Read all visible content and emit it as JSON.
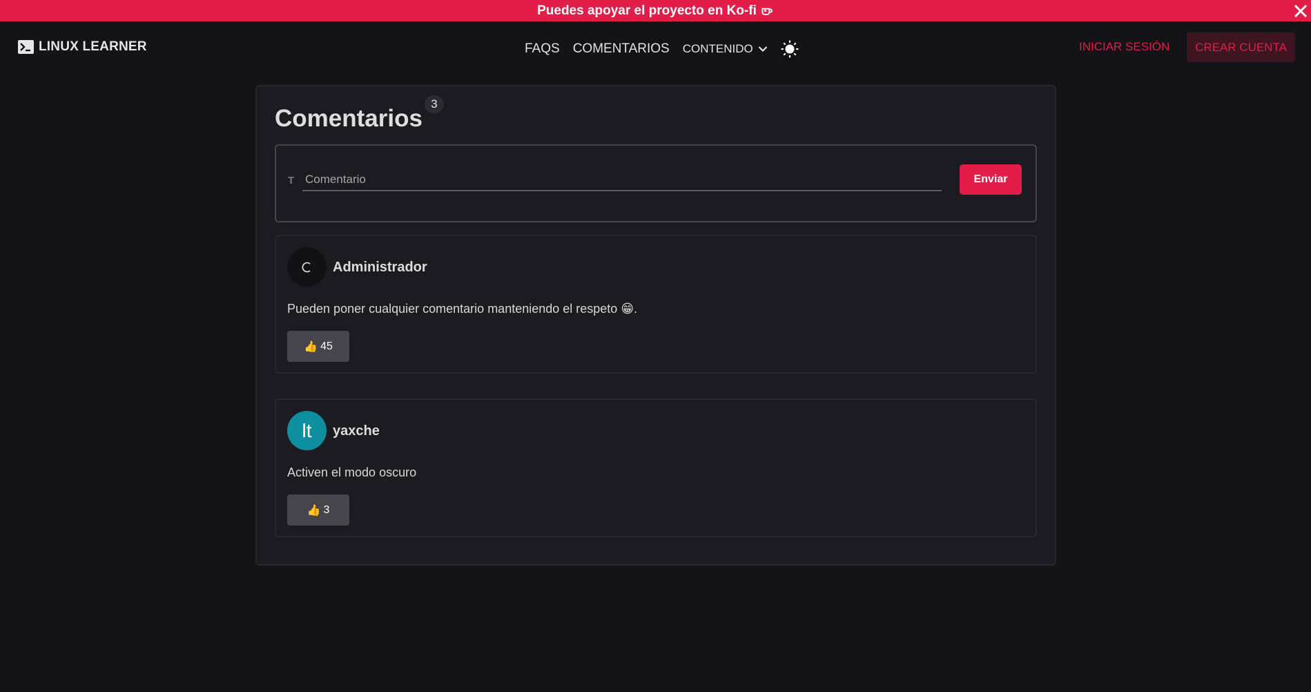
{
  "banner": {
    "text": "Puedes apoyar el proyecto en Ko-fi",
    "cup_icon": "coffee-cup-icon",
    "close_icon": "close-icon"
  },
  "navbar": {
    "brand": "LINUX LEARNER",
    "brand_icon": "terminal-icon",
    "links": [
      "FAQS",
      "COMENTARIOS"
    ],
    "dropdown_label": "CONTENIDO",
    "theme_icon": "sun-icon",
    "login_label": "INICIAR SESIÓN",
    "signup_label": "CREAR CUENTA"
  },
  "comments_section": {
    "title": "Comentarios",
    "count": "3",
    "input_placeholder": "Comentario",
    "input_value": "",
    "send_label": "Enviar"
  },
  "comments": [
    {
      "author": "Administrador",
      "avatar_text": "",
      "text": "Pueden poner cualquier comentario manteniendo el respeto 😁.",
      "likes": "45"
    },
    {
      "author": "yaxche",
      "avatar_text": "lt",
      "text": "Activen el modo oscuro",
      "likes": "3"
    }
  ],
  "colors": {
    "accent": "#e11d48",
    "background": "#141317",
    "card": "#1c1b21",
    "user_avatar": "#0e8fa0"
  }
}
